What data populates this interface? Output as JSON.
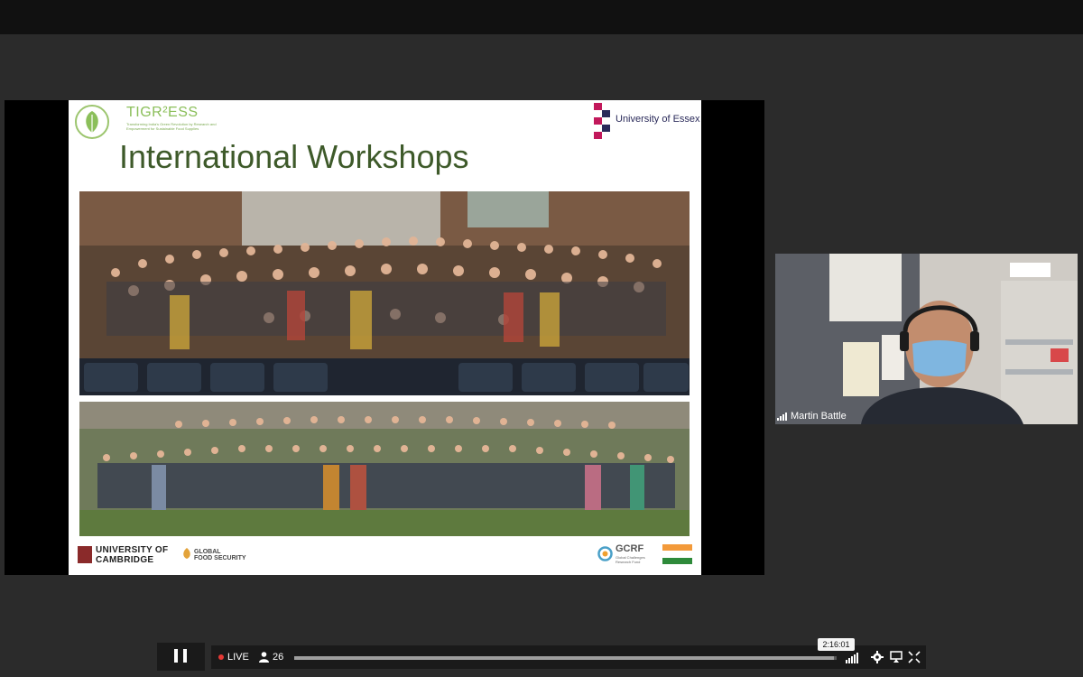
{
  "slide": {
    "title": "International Workshops",
    "tigress_name": "TIGR²ESS",
    "tigress_subtitle": "Transforming India's Green Revolution by Research and Empowerment for Sustainable Food Supplies",
    "essex_label": "University of Essex",
    "cambridge_label_line1": "UNIVERSITY OF",
    "cambridge_label_line2": "CAMBRIDGE",
    "gfs_label_line1": "GLOBAL",
    "gfs_label_line2": "FOOD SECURITY",
    "gcrf_label": "GCRF",
    "gcrf_subtitle": "Global Challenges Research Fund"
  },
  "participant": {
    "name": "Martin Battle"
  },
  "player": {
    "live_label": "LIVE",
    "viewer_count": "26",
    "time_tooltip": "2:16:01",
    "progress_fraction": 0.995
  },
  "icons": {
    "pause": "pause-icon",
    "viewers": "person-icon",
    "signal": "signal-icon",
    "settings": "gear-icon",
    "cast": "airplay-icon",
    "fullscreen": "fullscreen-icon"
  },
  "colors": {
    "live_dot": "#e53935",
    "title_green": "#3e5a2a",
    "background": "#2b2b2b"
  }
}
